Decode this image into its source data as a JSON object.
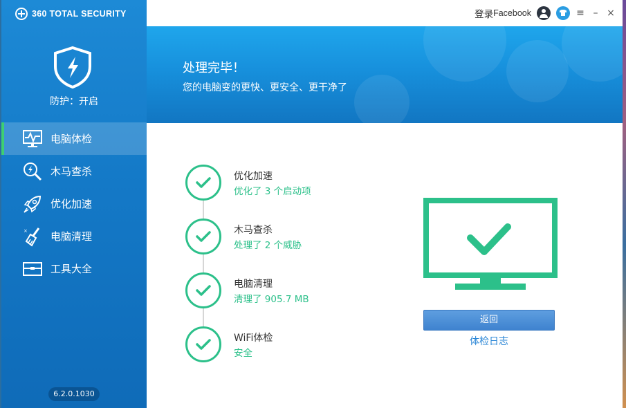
{
  "app": {
    "brand": "360 TOTAL SECURITY",
    "version": "6.2.0.1030",
    "accent_color": "#2cc08a",
    "brand_blue": "#1583d0"
  },
  "sidebar": {
    "protection_status": "防护：开启",
    "items": [
      {
        "label": "电脑体检",
        "icon": "monitor-pulse-icon",
        "active": true
      },
      {
        "label": "木马查杀",
        "icon": "magnifier-bolt-icon",
        "active": false
      },
      {
        "label": "优化加速",
        "icon": "rocket-icon",
        "active": false
      },
      {
        "label": "电脑清理",
        "icon": "broom-icon",
        "active": false
      },
      {
        "label": "工具大全",
        "icon": "toolbox-icon",
        "active": false
      }
    ]
  },
  "topbar": {
    "login": "登录",
    "facebook": "Facebook",
    "menu_icon": "hamburger-icon",
    "minimize_icon": "minimize-icon",
    "close_icon": "close-icon"
  },
  "banner": {
    "title": "处理完毕！",
    "subtitle": "您的电脑变的更快、更安全、更干净了"
  },
  "results": [
    {
      "title": "优化加速",
      "detail": "优化了 3 个启动项"
    },
    {
      "title": "木马查杀",
      "detail": "处理了 2 个威胁"
    },
    {
      "title": "电脑清理",
      "detail": "清理了 905.7 MB"
    },
    {
      "title": "WiFi体检",
      "detail": "安全"
    }
  ],
  "actions": {
    "return_label": "返回",
    "log_link": "体检日志"
  }
}
